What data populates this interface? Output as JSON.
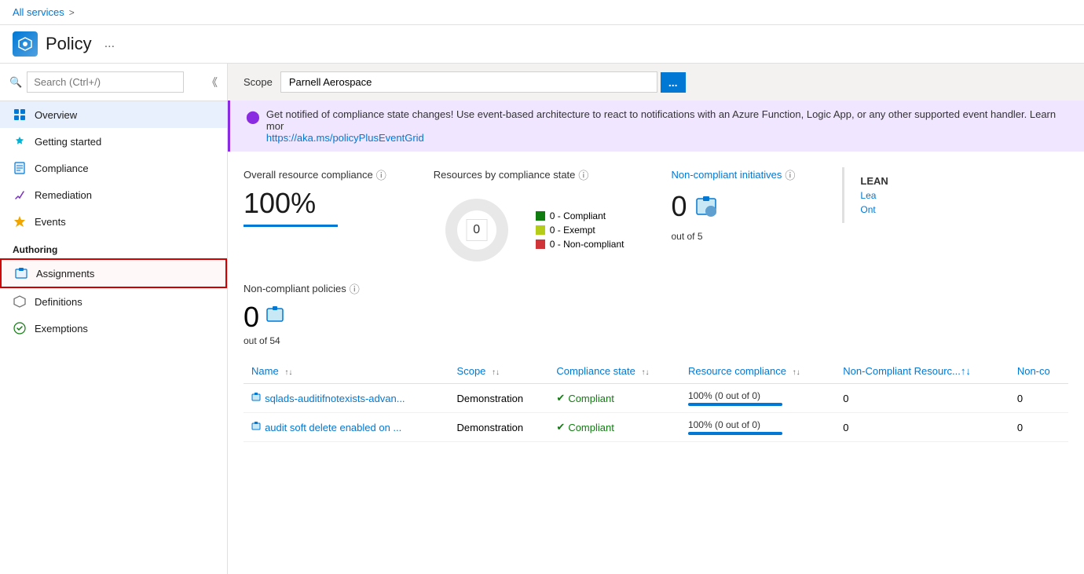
{
  "breadcrumb": {
    "allServices": "All services",
    "separator": ">"
  },
  "appHeader": {
    "title": "Policy",
    "more": "..."
  },
  "sidebar": {
    "searchPlaceholder": "Search (Ctrl+/)",
    "items": [
      {
        "label": "Overview",
        "icon": "overview"
      },
      {
        "label": "Getting started",
        "icon": "start"
      },
      {
        "label": "Compliance",
        "icon": "compliance"
      },
      {
        "label": "Remediation",
        "icon": "remediation"
      },
      {
        "label": "Events",
        "icon": "events"
      }
    ],
    "authoringSection": "Authoring",
    "authoringItems": [
      {
        "label": "Assignments",
        "icon": "assignments",
        "highlighted": true
      },
      {
        "label": "Definitions",
        "icon": "definitions",
        "highlighted": false
      },
      {
        "label": "Exemptions",
        "icon": "exemptions",
        "highlighted": false
      }
    ]
  },
  "scope": {
    "label": "Scope",
    "value": "Parnell Aerospace",
    "buttonLabel": "..."
  },
  "notification": {
    "text": "Get notified of compliance state changes! Use event-based architecture to react to notifications with an Azure Function, Logic App, or any other supported event handler. Learn mor",
    "link": "https://aka.ms/policyPlusEventGrid"
  },
  "metrics": {
    "overallCompliance": {
      "title": "Overall resource compliance",
      "value": "100%"
    },
    "resourcesByState": {
      "title": "Resources by compliance state",
      "donutCenter": "0",
      "legend": [
        {
          "label": "0 - Compliant",
          "color": "#107c10"
        },
        {
          "label": "0 - Exempt",
          "color": "#b5cc18"
        },
        {
          "label": "0 - Non-compliant",
          "color": "#d13438"
        }
      ]
    },
    "nonCompliantInitiatives": {
      "title": "Non-compliant initiatives",
      "value": "0",
      "outOf": "out of 5"
    }
  },
  "learnSection": {
    "title": "LEAN",
    "links": [
      "Lea",
      "Ont"
    ]
  },
  "nonCompliantPolicies": {
    "title": "Non-compliant policies",
    "value": "0",
    "outOf": "out of 54"
  },
  "table": {
    "columns": [
      "Name",
      "Scope",
      "Compliance state",
      "Resource compliance",
      "Non-Compliant Resourc...↑↓",
      "Non-co"
    ],
    "rows": [
      {
        "name": "sqlads-auditifnotexists-advan...",
        "scope": "Demonstration",
        "complianceState": "Compliant",
        "resourceCompliance": "100% (0 out of 0)",
        "nonCompliantResources": "0",
        "nonCompliant": "0",
        "barPercent": 100
      },
      {
        "name": "audit soft delete enabled on ...",
        "scope": "Demonstration",
        "complianceState": "Compliant",
        "resourceCompliance": "100% (0 out of 0)",
        "nonCompliantResources": "0",
        "nonCompliant": "0",
        "barPercent": 100
      }
    ]
  },
  "icons": {
    "search": "🔍",
    "overview": "⊞",
    "start": "✦",
    "compliance": "📋",
    "remediation": "🔧",
    "events": "⚡",
    "assignments": "📌",
    "definitions": "⬡",
    "exemptions": "✅",
    "info": "ⓘ",
    "sort": "↑↓",
    "check": "✔"
  }
}
